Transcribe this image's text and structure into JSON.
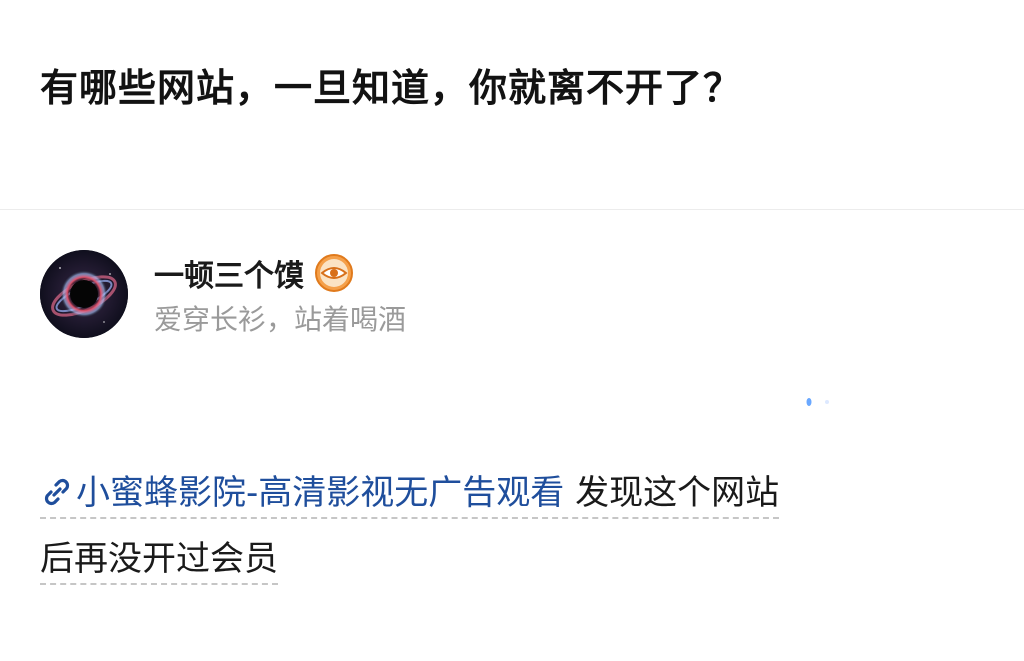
{
  "question": {
    "title": "有哪些网站，一旦知道，你就离不开了？"
  },
  "author": {
    "name": "一顿三个馍",
    "bio": "爱穿长衫，站着喝酒",
    "badge_icon": "eye-badge-icon",
    "avatar_icon": "black-hole-avatar"
  },
  "answer": {
    "link_icon": "link-icon",
    "link_text": "小蜜蜂影院-高清影视无广告观看",
    "text_after_link": " 发现这个网站",
    "line2": "后再没开过会员"
  },
  "colors": {
    "title": "#121212",
    "link": "#1f4e9c",
    "bio": "#9a9a9a",
    "badge": "#f08a24"
  }
}
